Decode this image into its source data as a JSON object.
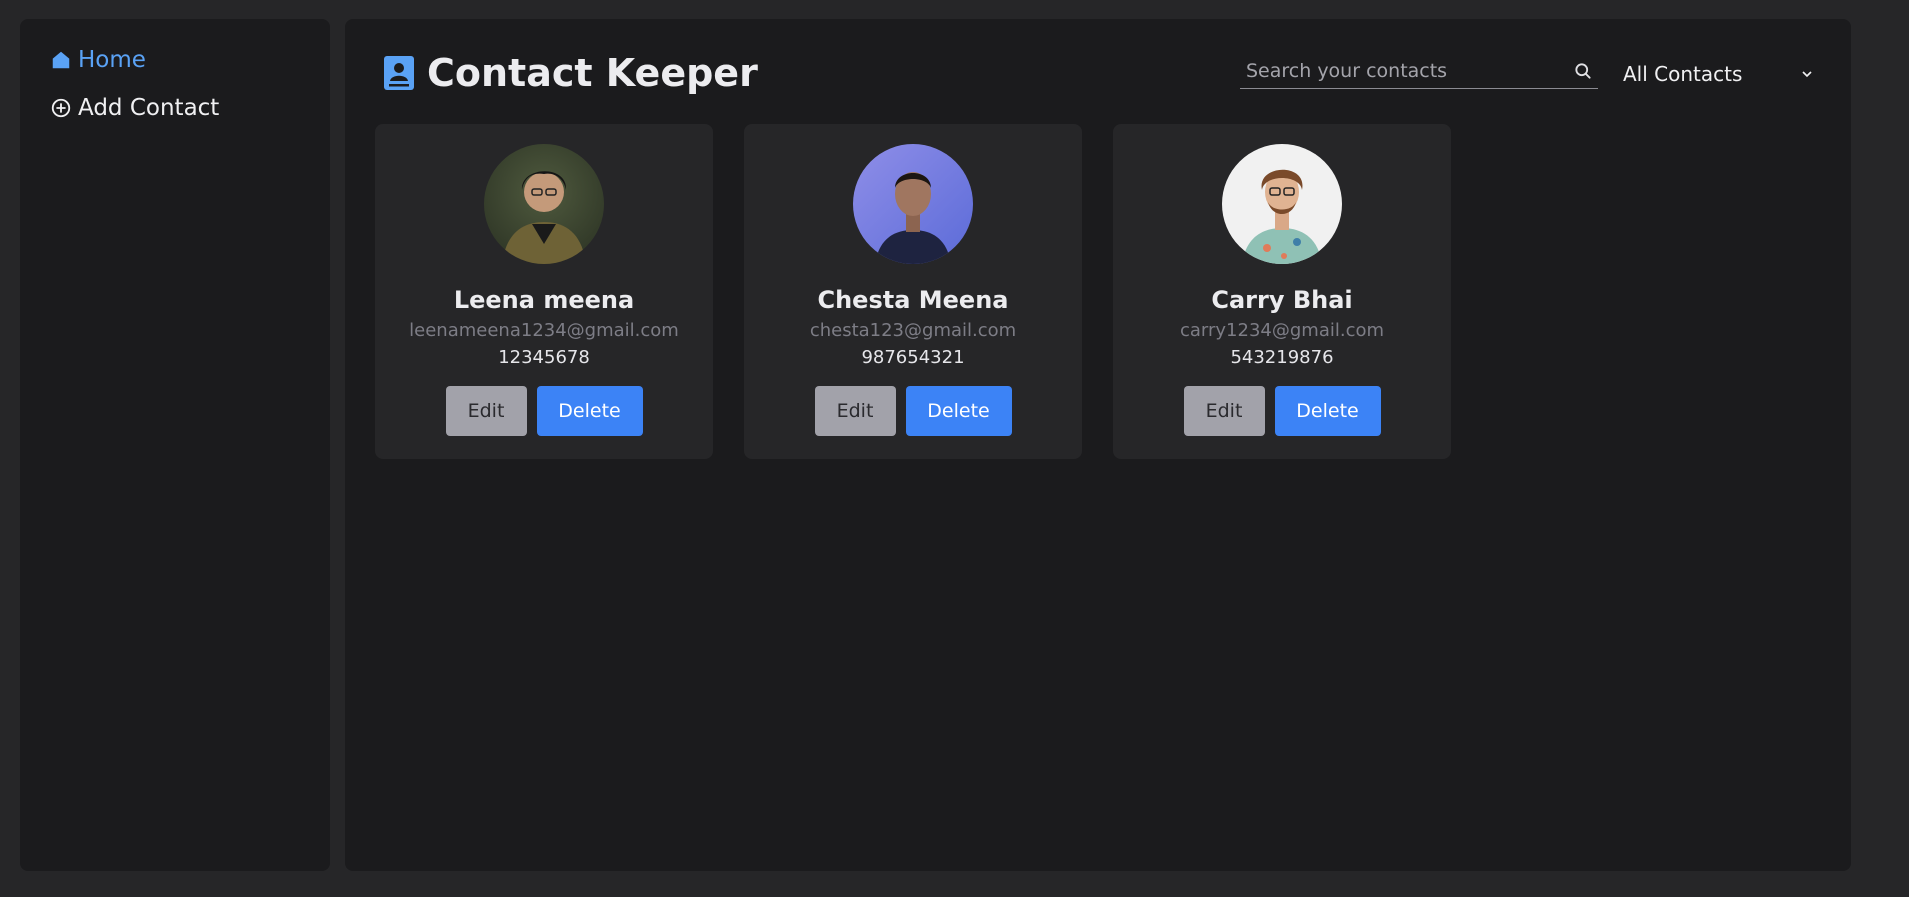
{
  "sidebar": {
    "items": [
      {
        "label": "Home",
        "icon": "home-icon",
        "active": true
      },
      {
        "label": "Add Contact",
        "icon": "plus-circle-icon",
        "active": false
      }
    ]
  },
  "header": {
    "title": "Contact Keeper",
    "icon": "contact-book-icon"
  },
  "search": {
    "placeholder": "Search your contacts",
    "value": ""
  },
  "filter": {
    "selected": "All Contacts"
  },
  "contacts": [
    {
      "name": "Leena meena",
      "email": "leenameena1234@gmail.com",
      "phone": "12345678"
    },
    {
      "name": "Chesta Meena",
      "email": "chesta123@gmail.com",
      "phone": "987654321"
    },
    {
      "name": "Carry Bhai",
      "email": "carry1234@gmail.com",
      "phone": "543219876"
    }
  ],
  "actions": {
    "edit_label": "Edit",
    "delete_label": "Delete"
  },
  "colors": {
    "accent": "#3c83f6",
    "active_nav": "#5aa2f5",
    "panel": "#1b1b1d",
    "card": "#262628"
  }
}
